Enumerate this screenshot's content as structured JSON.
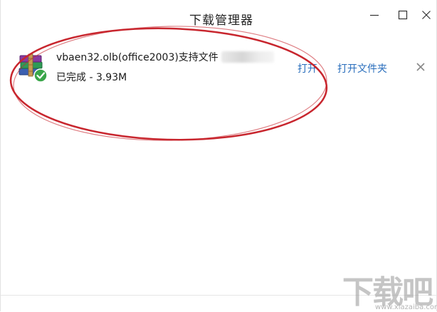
{
  "window": {
    "title": "下载管理器"
  },
  "download": {
    "file_name": "vbaen32.olb(office2003)支持文件",
    "status": "已完成 - 3.93M",
    "open_label": "打开",
    "open_folder_label": "打开文件夹"
  },
  "watermark": {
    "text": "下载吧",
    "subtext": "www.xiazaiba.com"
  },
  "colors": {
    "link": "#2b6fbd",
    "annotation": "#c8262e",
    "check_badge": "#3aa64a"
  }
}
